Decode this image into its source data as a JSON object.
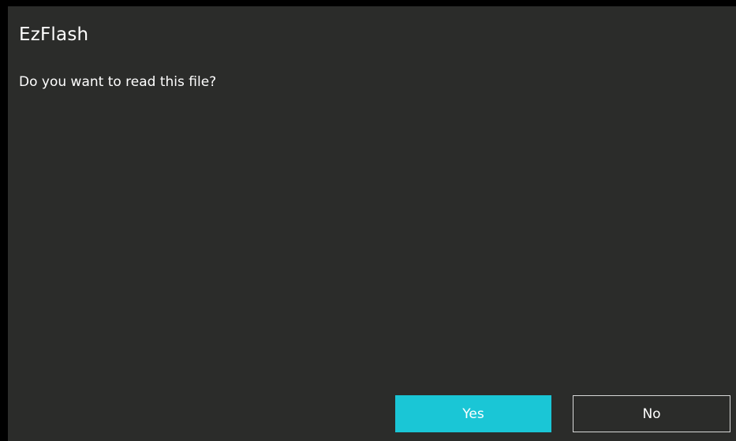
{
  "dialog": {
    "title": "EzFlash",
    "message": "Do you want to read this file?",
    "buttons": {
      "yes_label": "Yes",
      "no_label": "No"
    }
  },
  "colors": {
    "background": "#2b2c2a",
    "accent": "#1ac6d6",
    "text": "#ffffff",
    "outline": "#d8d8d8"
  }
}
